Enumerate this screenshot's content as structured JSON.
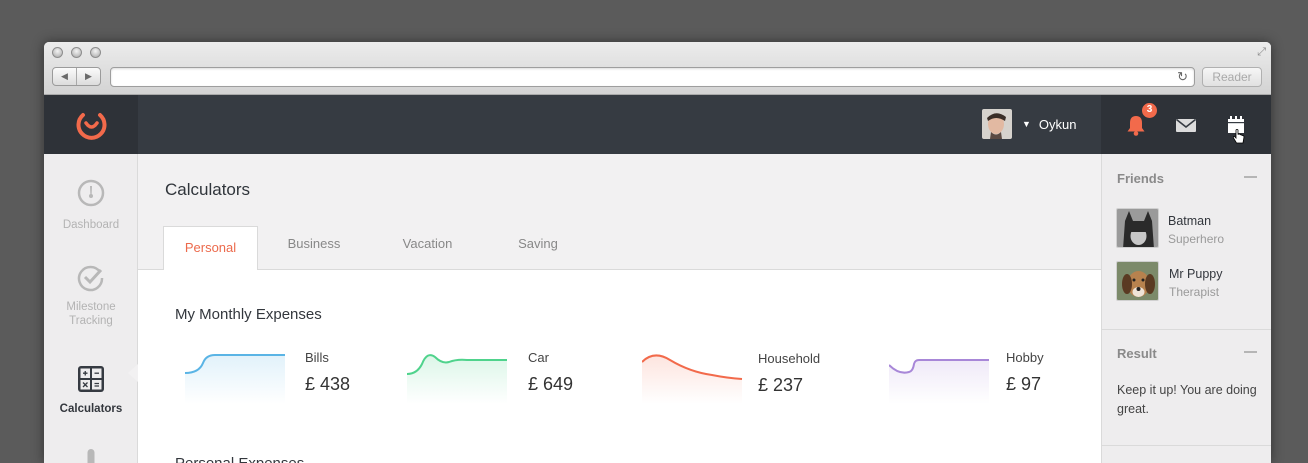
{
  "browser": {
    "reader_label": "Reader"
  },
  "header": {
    "user_name": "Oykun",
    "notification_count": "3",
    "accent_color": "#f26a4b"
  },
  "sidebar": {
    "items": [
      {
        "label": "Dashboard",
        "icon": "dashboard-icon"
      },
      {
        "label": "Milestone Tracking",
        "icon": "check-icon"
      },
      {
        "label": "Calculators",
        "icon": "calculator-icon",
        "active": true
      }
    ]
  },
  "main": {
    "title": "Calculators",
    "tabs": [
      {
        "label": "Personal",
        "active": true
      },
      {
        "label": "Business"
      },
      {
        "label": "Vacation"
      },
      {
        "label": "Saving"
      }
    ],
    "section_title": "My Monthly Expenses",
    "next_section_title": "Personal Expenses",
    "expenses": [
      {
        "label": "Bills",
        "amount": "£ 438",
        "color": "#5ab4e5"
      },
      {
        "label": "Car",
        "amount": "£ 649",
        "color": "#4fd38c"
      },
      {
        "label": "Household",
        "amount": "£ 237",
        "color": "#f26a4b"
      },
      {
        "label": "Hobby",
        "amount": "£ 97",
        "color": "#a887d8"
      }
    ]
  },
  "right_panel": {
    "friends_title": "Friends",
    "friends": [
      {
        "name": "Batman",
        "role": "Superhero"
      },
      {
        "name": "Mr Puppy",
        "role": "Therapist"
      }
    ],
    "result_title": "Result",
    "result_text": "Keep it up! You are doing great."
  }
}
